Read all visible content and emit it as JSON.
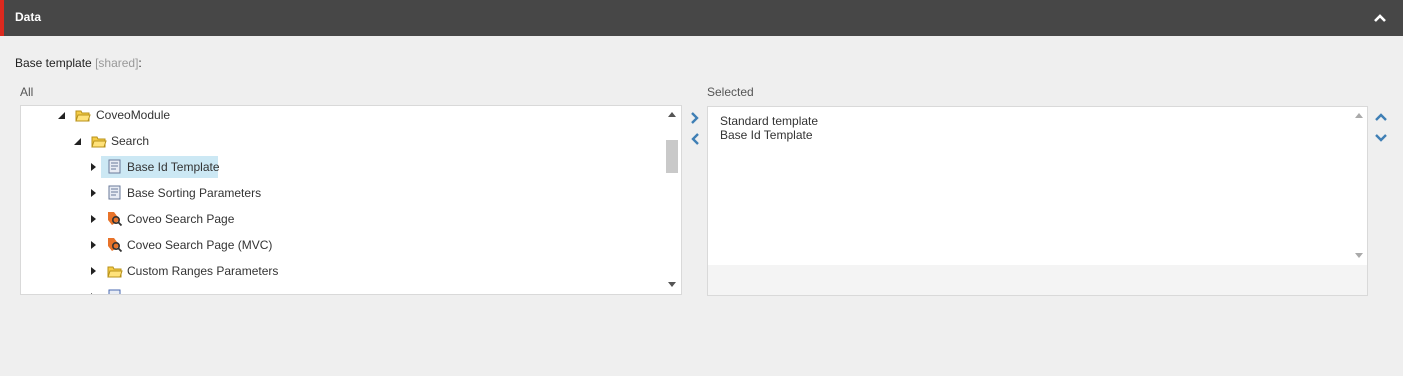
{
  "header": {
    "title": "Data"
  },
  "field": {
    "label": "Base template",
    "shared": "[shared]",
    "colon": ":"
  },
  "all_label": "All",
  "selected_label": "Selected",
  "tree": {
    "items": [
      {
        "label": "CoveoModule",
        "icon": "folder-icon",
        "toggle": "expanded"
      },
      {
        "label": "Search",
        "icon": "folder-icon",
        "toggle": "expanded"
      },
      {
        "label": "Base Id Template",
        "icon": "template-icon",
        "toggle": "collapsed",
        "selected": true
      },
      {
        "label": "Base Sorting Parameters",
        "icon": "template-icon",
        "toggle": "collapsed"
      },
      {
        "label": "Coveo Search Page",
        "icon": "coveo-search-icon",
        "toggle": "collapsed"
      },
      {
        "label": "Coveo Search Page (MVC)",
        "icon": "coveo-search-icon",
        "toggle": "collapsed"
      },
      {
        "label": "Custom Ranges Parameters",
        "icon": "folder-icon",
        "toggle": "collapsed"
      }
    ]
  },
  "selected": {
    "items": [
      "Standard template",
      "Base Id Template"
    ]
  },
  "colors": {
    "accent": "#dc291e",
    "header_bg": "#474747",
    "selection": "#cce8f4",
    "arrow": "#3f7fb5"
  }
}
